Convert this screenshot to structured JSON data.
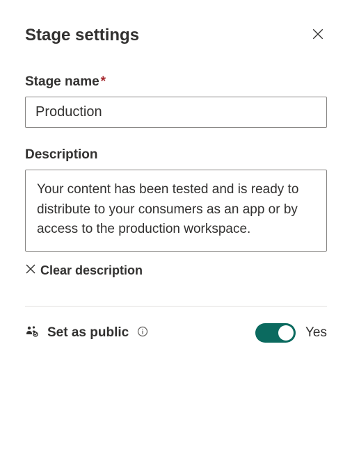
{
  "header": {
    "title": "Stage settings"
  },
  "fields": {
    "stage_name": {
      "label": "Stage name",
      "required_marker": "*",
      "value": "Production"
    },
    "description": {
      "label": "Description",
      "value": "Your content has been tested and is ready to distribute to your consumers as an app or by access to the production workspace.",
      "clear_label": "Clear description"
    }
  },
  "public": {
    "label": "Set as public",
    "toggle_label": "Yes"
  }
}
